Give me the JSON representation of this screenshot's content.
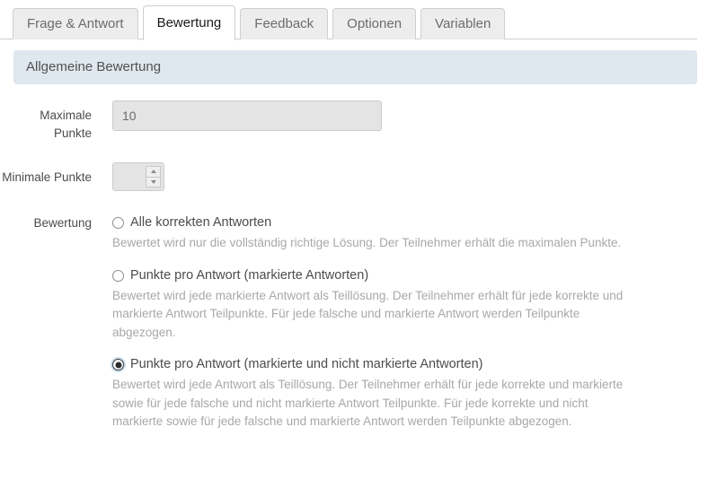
{
  "tabs": [
    {
      "label": "Frage & Antwort",
      "active": false
    },
    {
      "label": "Bewertung",
      "active": true
    },
    {
      "label": "Feedback",
      "active": false
    },
    {
      "label": "Optionen",
      "active": false
    },
    {
      "label": "Variablen",
      "active": false
    }
  ],
  "section": {
    "title": "Allgemeine Bewertung"
  },
  "fields": {
    "max_points": {
      "label": "Maximale Punkte",
      "value": "10",
      "placeholder": ""
    },
    "min_points": {
      "label": "Minimale Punkte",
      "value": "",
      "placeholder": ""
    },
    "scoring": {
      "label": "Bewertung",
      "options": [
        {
          "label": "Alle korrekten Antworten",
          "description": "Bewertet wird nur die vollständig richtige Lösung. Der Teilnehmer erhält die maximalen Punkte.",
          "checked": false
        },
        {
          "label": "Punkte pro Antwort (markierte Antworten)",
          "description": "Bewertet wird jede markierte Antwort als Teillösung. Der Teilnehmer erhält für jede korrekte und markierte Antwort Teilpunkte. Für jede falsche und markierte Antwort werden Teilpunkte abgezogen.",
          "checked": false
        },
        {
          "label": "Punkte pro Antwort (markierte und nicht markierte Antworten)",
          "description": "Bewertet wird jede Antwort als Teillösung. Der Teilnehmer erhält für jede korrekte und markierte sowie für jede falsche und nicht markierte Antwort Teilpunkte. Für jede korrekte und nicht markierte sowie für jede falsche und markierte Antwort werden Teilpunkte abgezogen.",
          "checked": true
        }
      ]
    }
  },
  "colors": {
    "section_header_bg": "#dfe7ef",
    "tab_inactive_bg": "#ededed",
    "tab_active_bg": "#ffffff",
    "input_disabled_bg": "#e4e4e4",
    "description_text": "#a8a8a8"
  }
}
